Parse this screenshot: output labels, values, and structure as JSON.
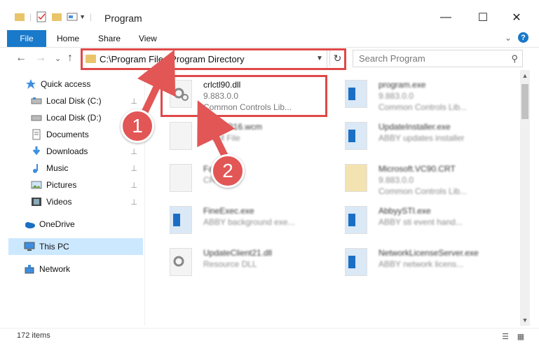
{
  "window": {
    "title": "Program",
    "minimize": "—",
    "maximize": "☐",
    "close": "✕"
  },
  "ribbon": {
    "file": "File",
    "tabs": [
      "Home",
      "Share",
      "View"
    ],
    "expand": "⌄",
    "help": "?"
  },
  "nav": {
    "back": "←",
    "forward": "→",
    "recent": "⌄",
    "up": "↑",
    "address": "C:\\Program Files\\Program Directory",
    "refresh": "↻",
    "search_placeholder": "Search Program",
    "search_icon": "⚲"
  },
  "sidebar": {
    "items": [
      {
        "label": "Quick access",
        "icon": "star-icon"
      },
      {
        "label": "Local Disk (C:)",
        "icon": "drive-icon",
        "pin": "📌"
      },
      {
        "label": "Local Disk (D:)",
        "icon": "drive-icon"
      },
      {
        "label": "Documents",
        "icon": "documents-icon",
        "pin": "📌"
      },
      {
        "label": "Downloads",
        "icon": "downloads-icon",
        "pin": "📌"
      },
      {
        "label": "Music",
        "icon": "music-icon",
        "pin": "📌"
      },
      {
        "label": "Pictures",
        "icon": "pictures-icon",
        "pin": "📌"
      },
      {
        "label": "Videos",
        "icon": "videos-icon",
        "pin": "📌"
      },
      {
        "label": "OneDrive",
        "icon": "onedrive-icon"
      },
      {
        "label": "This PC",
        "icon": "pc-icon"
      },
      {
        "label": "Network",
        "icon": "network-icon"
      }
    ]
  },
  "files": [
    {
      "name": "crlctl90.dll",
      "version": "9.883.0.0",
      "desc": "Common Controls Lib..."
    },
    {
      "name": "program.exe",
      "version": "9.883.0.0",
      "desc": "Common Controls Lib..."
    },
    {
      "name": "1...oWP16.wcm",
      "version": "WCM File",
      "desc": ""
    },
    {
      "name": "UpdateInstaller.exe",
      "version": "ABBY updates installer",
      "desc": ""
    },
    {
      "name": "FastE...e",
      "version": "CRT...",
      "desc": ""
    },
    {
      "name": "Microsoft.VC90.CRT",
      "version": "9.883.0.0",
      "desc": "Common Controls Lib..."
    },
    {
      "name": "FineExec.exe",
      "version": "ABBY background exe...",
      "desc": ""
    },
    {
      "name": "AbbyySTI.exe",
      "version": "ABBY sti event hand...",
      "desc": ""
    },
    {
      "name": "UpdateClient21.dll",
      "version": "Resource DLL",
      "desc": ""
    },
    {
      "name": "NetworkLicenseServer.exe",
      "version": "ABBY network licens...",
      "desc": ""
    }
  ],
  "status": {
    "count": "172 items",
    "details_view": "☰",
    "icons_view": "▦"
  },
  "annotations": {
    "step1": "1",
    "step2": "2",
    "color": "#e25656"
  }
}
